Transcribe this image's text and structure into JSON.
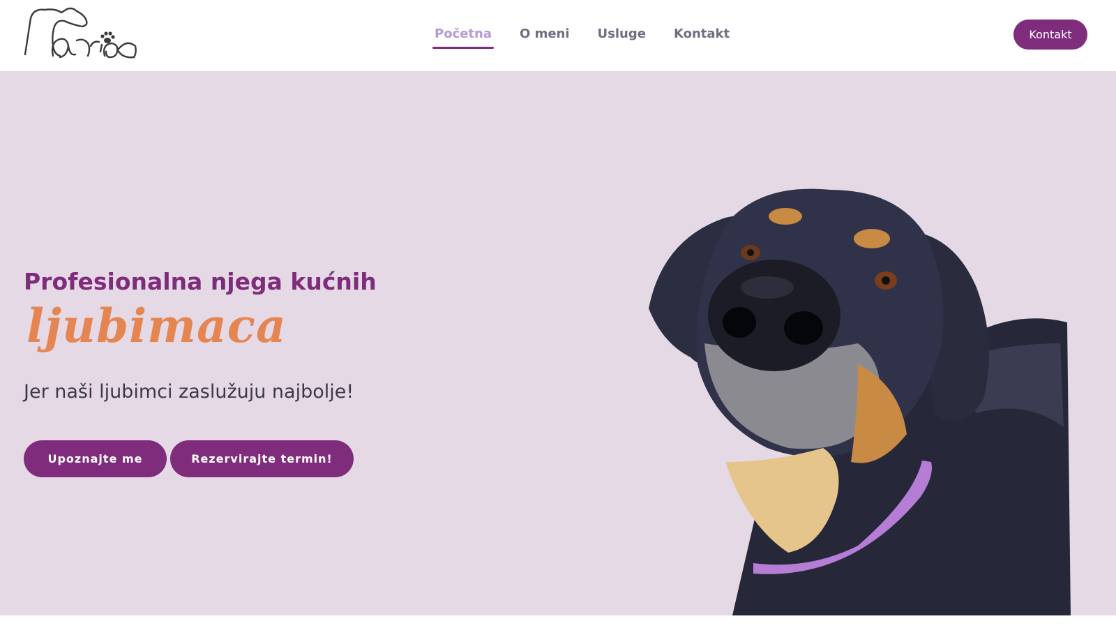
{
  "header": {
    "logo_alt": "Maria logo",
    "nav": [
      {
        "label": "Početna",
        "active": true
      },
      {
        "label": "O meni",
        "active": false
      },
      {
        "label": "Usluge",
        "active": false
      },
      {
        "label": "Kontakt",
        "active": false
      }
    ],
    "cta_label": "Kontakt"
  },
  "hero": {
    "title": "Profesionalna njega kućnih",
    "title_script": "ljubimaca",
    "subtitle": "Jer naši ljubimci zaslužuju najbolje!",
    "primary_button": "Upoznajte me",
    "secondary_button": "Rezervirajte termin!",
    "image_subject": "dog-photo"
  },
  "colors": {
    "brand_purple": "#7f2c7c",
    "nav_active": "#b49ad6",
    "accent_orange": "#e58652",
    "hero_bg": "#e5d9e6"
  }
}
